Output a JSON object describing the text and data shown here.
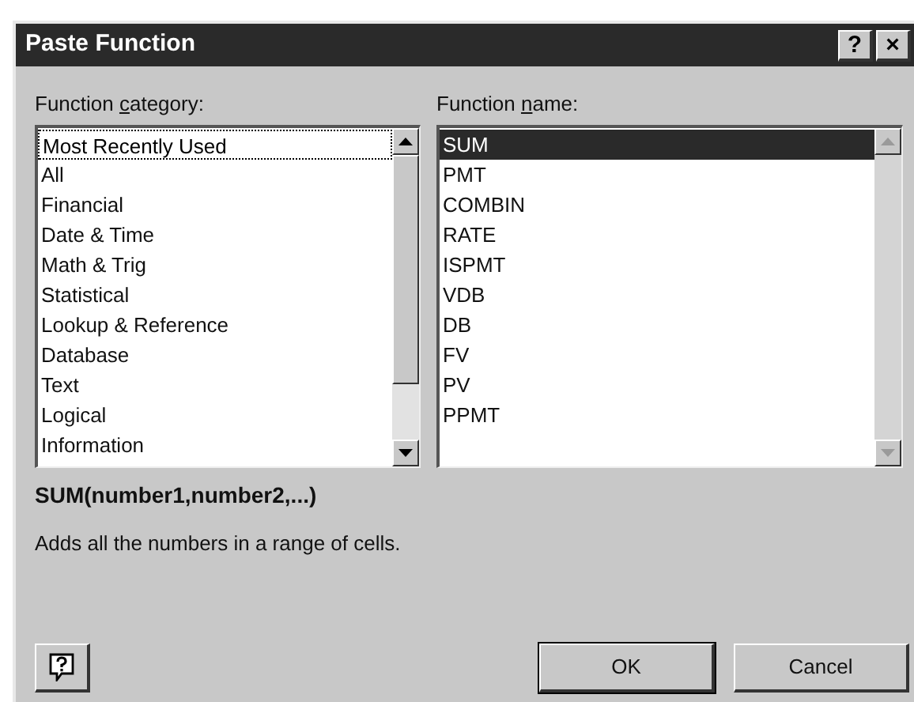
{
  "window": {
    "title": "Paste Function",
    "title_buttons": [
      "?",
      "×"
    ]
  },
  "lists": [
    {
      "label_parts": [
        "Function ",
        "c",
        "ategory:"
      ],
      "has_focus": true,
      "scroll_disabled": false,
      "items": [
        {
          "label": "Most Recently Used",
          "selected": true
        },
        {
          "label": "All",
          "selected": false
        },
        {
          "label": "Financial",
          "selected": false
        },
        {
          "label": "Date & Time",
          "selected": false
        },
        {
          "label": "Math & Trig",
          "selected": false
        },
        {
          "label": "Statistical",
          "selected": false
        },
        {
          "label": "Lookup & Reference",
          "selected": false
        },
        {
          "label": "Database",
          "selected": false
        },
        {
          "label": "Text",
          "selected": false
        },
        {
          "label": "Logical",
          "selected": false
        },
        {
          "label": "Information",
          "selected": false
        }
      ]
    },
    {
      "label_parts": [
        "Function ",
        "n",
        "ame:"
      ],
      "has_focus": false,
      "scroll_disabled": true,
      "items": [
        {
          "label": "SUM",
          "selected": true
        },
        {
          "label": "PMT",
          "selected": false
        },
        {
          "label": "COMBIN",
          "selected": false
        },
        {
          "label": "RATE",
          "selected": false
        },
        {
          "label": "ISPMT",
          "selected": false
        },
        {
          "label": "VDB",
          "selected": false
        },
        {
          "label": "DB",
          "selected": false
        },
        {
          "label": "FV",
          "selected": false
        },
        {
          "label": "PV",
          "selected": false
        },
        {
          "label": "PPMT",
          "selected": false
        }
      ]
    }
  ],
  "syntax": "SUM(number1,number2,...)",
  "description": "Adds all the numbers in a range of cells.",
  "buttons": [
    "OK",
    "Cancel"
  ]
}
